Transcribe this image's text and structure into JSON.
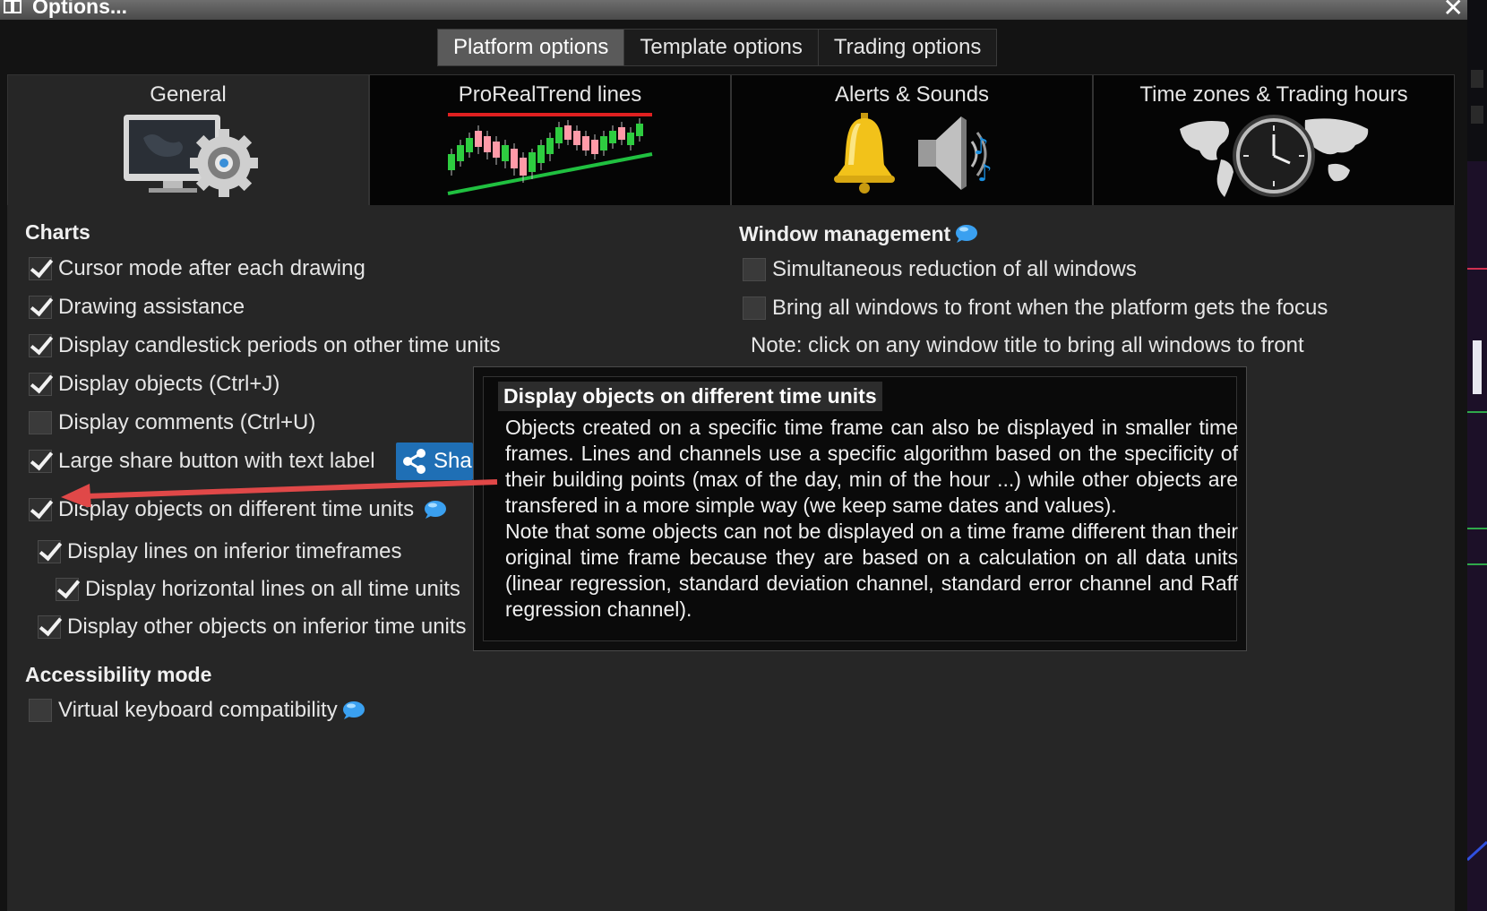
{
  "window": {
    "title": "Options..."
  },
  "top_tabs": [
    {
      "label": "Platform options",
      "active": true
    },
    {
      "label": "Template options",
      "active": false
    },
    {
      "label": "Trading options",
      "active": false
    }
  ],
  "categories": [
    {
      "label": "General",
      "icon": "computer-gear-icon",
      "active": true
    },
    {
      "label": "ProRealTrend lines",
      "icon": "trend-lines-chart-icon",
      "active": false
    },
    {
      "label": "Alerts & Sounds",
      "icon": "bell-speaker-icon",
      "active": false
    },
    {
      "label": "Time zones & Trading hours",
      "icon": "world-clock-icon",
      "active": false
    }
  ],
  "charts": {
    "heading": "Charts",
    "options": [
      {
        "label": "Cursor mode after each drawing",
        "checked": true
      },
      {
        "label": "Drawing assistance",
        "checked": true
      },
      {
        "label": "Display candlestick periods on other time units",
        "checked": true
      },
      {
        "label": "Display objects (Ctrl+J)",
        "checked": true
      },
      {
        "label": "Display comments (Ctrl+U)",
        "checked": false
      },
      {
        "label": "Large share button with text label",
        "checked": true
      },
      {
        "label": "Display objects on different time units",
        "checked": true
      },
      {
        "label": "Display lines on inferior timeframes",
        "checked": true
      },
      {
        "label": "Display horizontal lines on all time units",
        "checked": true
      },
      {
        "label": "Display other objects on inferior time units",
        "checked": true
      }
    ],
    "share_button_label": "Share"
  },
  "window_management": {
    "heading": "Window management",
    "options": [
      {
        "label": "Simultaneous reduction of all windows",
        "checked": false
      },
      {
        "label": "Bring all windows to front when the platform gets the focus",
        "checked": false
      }
    ],
    "note": "Note: click on any window title to bring all windows to front"
  },
  "accessibility": {
    "heading": "Accessibility mode",
    "options": [
      {
        "label": "Virtual keyboard compatibility",
        "checked": false
      }
    ]
  },
  "tooltip": {
    "title": "Display objects on different time units",
    "paragraph1": "Objects created on a specific time frame can also be displayed in smaller time frames. Lines and channels use a specific algorithm based on the specificity of their building points (max of the day, min of the hour ...) while other objects are transfered in a more simple way (we keep same dates and values).",
    "paragraph2": "Note that some objects can not be displayed on a time frame different than their original time frame because they are based on a calculation on all data units (linear regression, standard deviation channel, standard error channel and Raff regression channel)."
  },
  "colors": {
    "accent_arrow": "#e04848",
    "share_button": "#1f6fb5",
    "info_bubble": "#3aa0f0"
  }
}
